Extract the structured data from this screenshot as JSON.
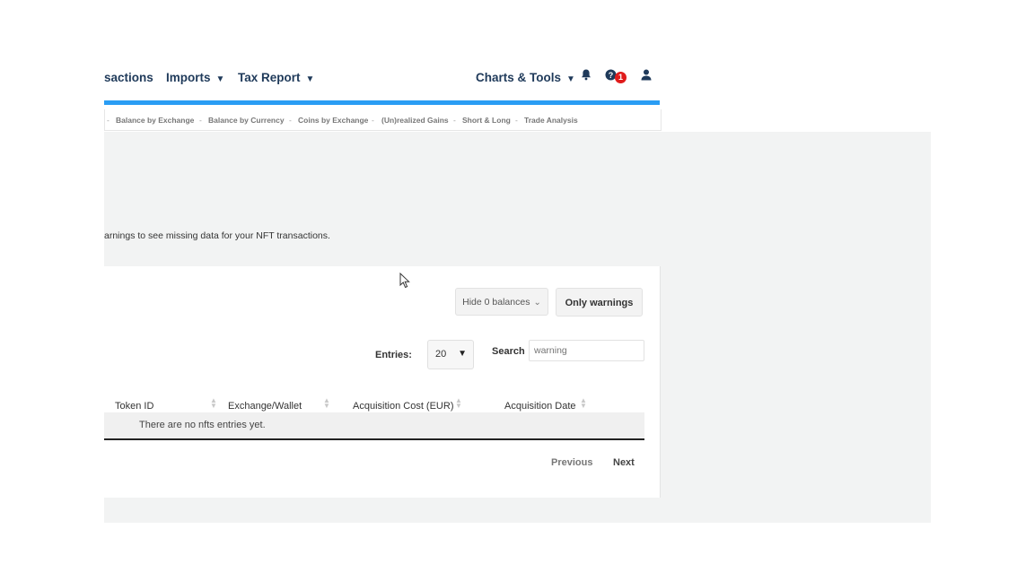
{
  "topnav": {
    "items": [
      {
        "label": "sactions",
        "caret": ""
      },
      {
        "label": "Imports",
        "caret": "▼"
      },
      {
        "label": "Tax Report",
        "caret": "▼"
      },
      {
        "label": "Charts & Tools",
        "caret": "▼"
      }
    ],
    "help_badge": "1"
  },
  "subnav": {
    "items": [
      "Balance by Exchange",
      "Balance by Currency",
      "Coins by Exchange",
      "(Un)realized Gains",
      "Short & Long",
      "Trade Analysis"
    ]
  },
  "info_text": "arnings to see missing data for your NFT transactions.",
  "controls": {
    "hide_balances": "Hide 0 balances",
    "only_warnings": "Only warnings",
    "entries_label": "Entries:",
    "entries_value": "20",
    "search_label": "Search",
    "search_placeholder": "warning"
  },
  "table": {
    "headers": [
      "Token ID",
      "Exchange/Wallet",
      "Acquisition Cost (EUR)",
      "Acquisition Date"
    ],
    "empty_message": "There are no nfts entries yet."
  },
  "pager": {
    "previous": "Previous",
    "next": "Next"
  },
  "colors": {
    "accent": "#2a9df4",
    "nav_text": "#1f3a5a",
    "badge": "#e01b1b"
  }
}
